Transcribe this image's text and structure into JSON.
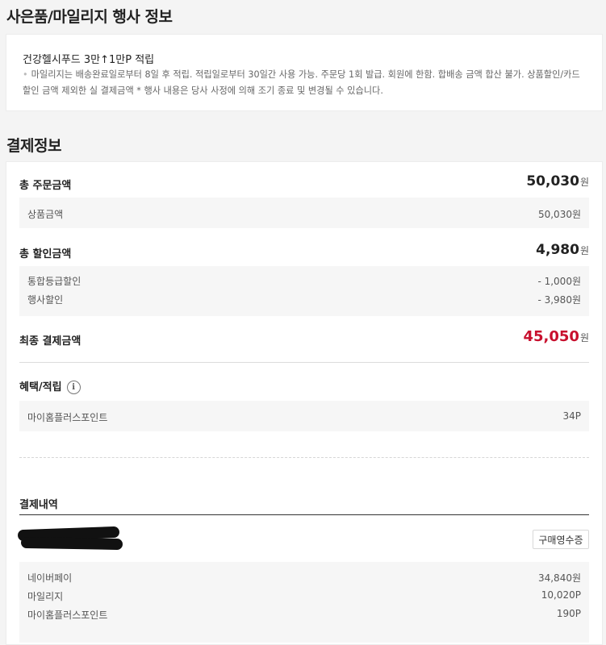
{
  "gift_section": {
    "title": "사은품/마일리지 행사 정보",
    "promo_title": "건강헬시푸드 3만↑1만P 적립",
    "promo_desc": "마일리지는 배송완료일로부터 8일 후 적립. 적립일로부터 30일간 사용 가능. 주문당 1회 발급. 회원에 한함. 합배송 금액 합산 불가. 상품할인/카드할인 금액 제외한 실 결제금액 * 행사 내용은 당사 사정에 의해 조기 종료 및 변경될 수 있습니다."
  },
  "payment": {
    "title": "결제정보",
    "total_order_label": "총 주문금액",
    "total_order_amount": "50,030",
    "currency": "원",
    "product_amount_label": "상품금액",
    "product_amount": "50,030원",
    "total_discount_label": "총 할인금액",
    "total_discount_amount": "4,980",
    "discounts": [
      {
        "label": "통합등급할인",
        "value": "- 1,000원"
      },
      {
        "label": "행사할인",
        "value": "- 3,980원"
      }
    ],
    "final_label": "최종 결제금액",
    "final_amount": "45,050",
    "benefit_label": "혜택/적립",
    "info_icon_glyph": "i",
    "benefit_item_label": "마이홈플러스포인트",
    "benefit_item_value": "34P"
  },
  "history": {
    "title": "결제내역",
    "receipt_button": "구매영수증",
    "items": [
      {
        "label": "네이버페이",
        "value": "34,840원"
      },
      {
        "label": "마일리지",
        "value": "10,020P"
      },
      {
        "label": "마이홈플러스포인트",
        "value": "190P"
      }
    ]
  },
  "colors": {
    "accent_red": "#c8102e"
  }
}
